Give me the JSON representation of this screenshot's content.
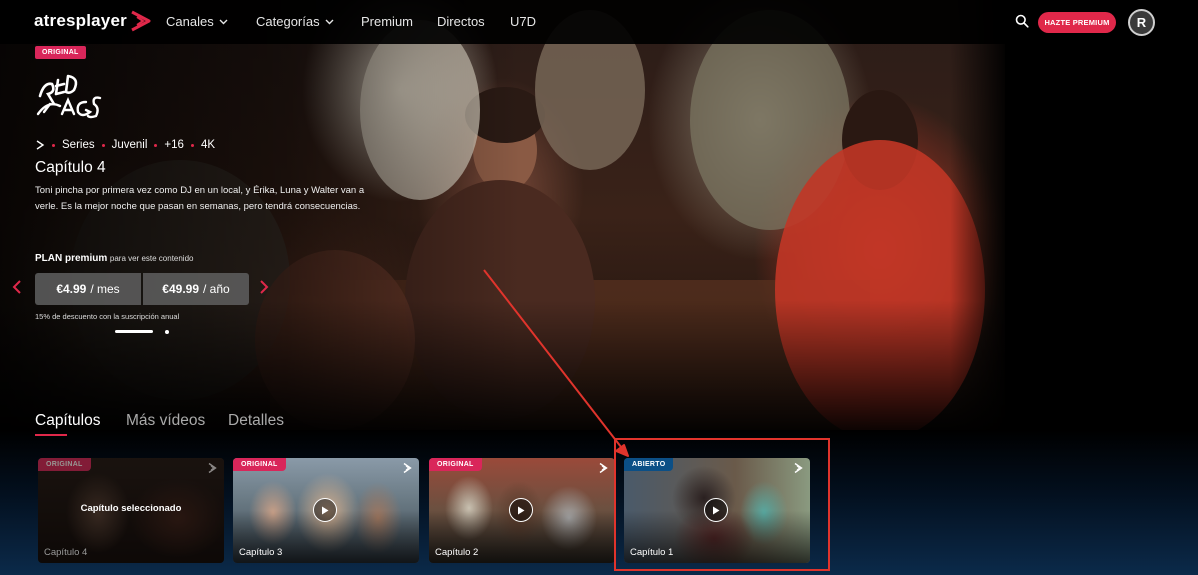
{
  "nav": {
    "logo_text": "atresplayer",
    "items": [
      {
        "label": "Canales",
        "dropdown": true
      },
      {
        "label": "Categorías",
        "dropdown": true
      },
      {
        "label": "Premium",
        "dropdown": false
      },
      {
        "label": "Directos",
        "dropdown": false
      },
      {
        "label": "U7D",
        "dropdown": false
      }
    ],
    "search_icon": "search-icon",
    "cta_label": "HAZTE PREMIUM",
    "avatar_initial": "R"
  },
  "hero": {
    "badge": "ORIGINAL",
    "show_logo_text": "RED FLAGS",
    "meta": {
      "type": "Series",
      "genre": "Juvenil",
      "rating": "+16",
      "quality": "4K"
    },
    "episode_title": "Capítulo 4",
    "synopsis": "Toni pincha por primera vez como DJ en un local, y Érika, Luna y Walter van a verle. Es la mejor noche que pasan en semanas, pero tendrá consecuencias.",
    "plan_label": "PLAN premium",
    "plan_suffix": "para ver este contenido",
    "price_month": {
      "amount": "€4.99",
      "period": "/ mes"
    },
    "price_year": {
      "amount": "€49.99",
      "period": "/ año"
    },
    "discount_note": "15% de descuento con la suscripción anual",
    "carousel": {
      "total": 2,
      "active_index": 0
    }
  },
  "tabs": [
    {
      "label": "Capítulos",
      "active": true
    },
    {
      "label": "Más vídeos",
      "active": false
    },
    {
      "label": "Detalles",
      "active": false
    }
  ],
  "episodes": [
    {
      "title": "Capítulo 4",
      "badge": "ORIGINAL",
      "badge_color": "#d9265a",
      "selected": true,
      "selected_label": "Capítulo seleccionado"
    },
    {
      "title": "Capítulo 3",
      "badge": "ORIGINAL",
      "badge_color": "#d9265a",
      "selected": false
    },
    {
      "title": "Capítulo 2",
      "badge": "ORIGINAL",
      "badge_color": "#d9265a",
      "selected": false
    },
    {
      "title": "Capítulo 1",
      "badge": "ABIERTO",
      "badge_color": "#0b4f86",
      "selected": false
    }
  ],
  "colors": {
    "accent": "#e0284a",
    "annotation": "#e0342c",
    "open_badge": "#0b4f86"
  }
}
